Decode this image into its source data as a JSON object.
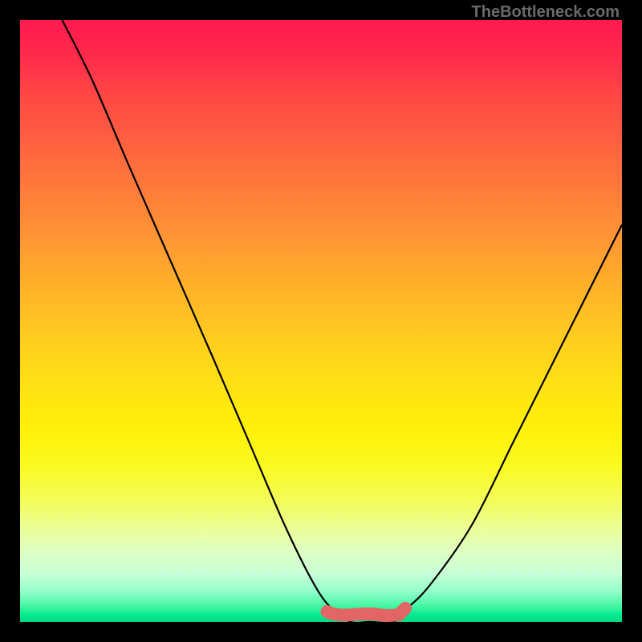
{
  "attribution": "TheBottleneck.com",
  "chart_data": {
    "type": "line",
    "title": "",
    "xlabel": "",
    "ylabel": "",
    "xlim": [
      0,
      100
    ],
    "ylim": [
      0,
      100
    ],
    "series": [
      {
        "name": "bottleneck-curve",
        "x": [
          7,
          12,
          18,
          25,
          32,
          38,
          44,
          49,
          52,
          55,
          58,
          62,
          64,
          68,
          75,
          82,
          90,
          100
        ],
        "y": [
          100,
          90,
          76,
          60,
          44,
          30,
          16,
          6,
          2,
          0,
          0,
          0,
          2,
          6,
          16,
          30,
          46,
          66
        ]
      }
    ],
    "highlight_band": {
      "name": "optimal-range",
      "x_start": 51,
      "x_end": 64,
      "y": 0,
      "color": "#e36666"
    },
    "background_gradient": {
      "top": "#ff1a4f",
      "mid": "#ffe015",
      "bottom": "#00d880"
    }
  }
}
